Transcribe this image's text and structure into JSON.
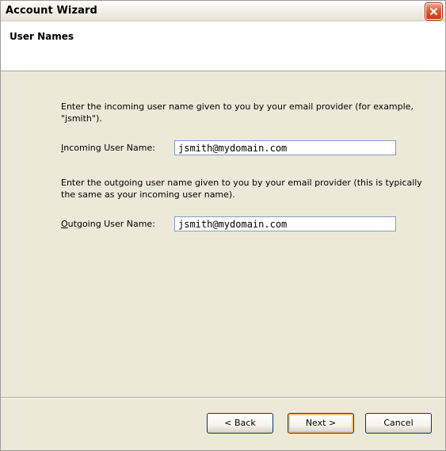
{
  "window": {
    "title": "Account Wizard"
  },
  "header": {
    "title": "User Names"
  },
  "incoming": {
    "description": "Enter the incoming user name given to you by your email provider (for example, \"jsmith\").",
    "label_mnemonic": "I",
    "label_rest": "ncoming User Name:",
    "value": "jsmith@mydomain.com"
  },
  "outgoing": {
    "description": "Enter the outgoing user name given to you by your email provider (this is typically the same as your incoming user name).",
    "label_mnemonic": "O",
    "label_rest": "utgoing User Name:",
    "value": "jsmith@mydomain.com"
  },
  "buttons": {
    "back": "< Back",
    "next": "Next >",
    "cancel": "Cancel"
  },
  "icons": {
    "close": "close-icon"
  }
}
